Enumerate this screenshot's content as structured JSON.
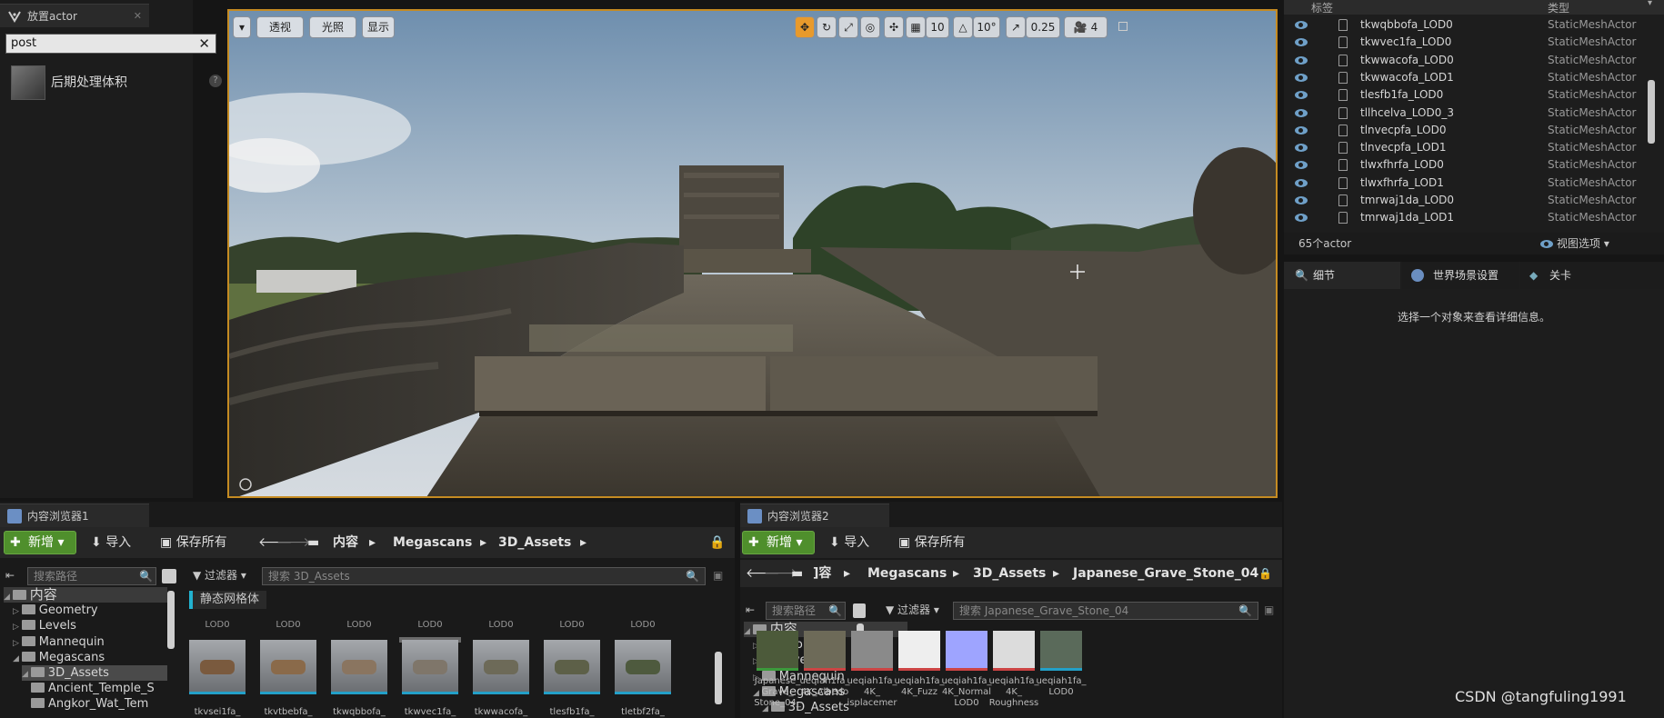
{
  "place_panel": {
    "tab": "放置actor",
    "search_value": "post",
    "item_label": "后期处理体积"
  },
  "viewport": {
    "perspective_label": "透视",
    "lighting_label": "光照",
    "show_label": "显示",
    "grid_snap": "10",
    "rotation_snap": "10°",
    "scale_snap": "0.25",
    "camera_speed": "4"
  },
  "outliner": {
    "col_label": "标签",
    "col_type": "类型",
    "rows": [
      {
        "name": "tkwqbbofa_LOD0",
        "type": "StaticMeshActor"
      },
      {
        "name": "tkwvec1fa_LOD0",
        "type": "StaticMeshActor"
      },
      {
        "name": "tkwwacofa_LOD0",
        "type": "StaticMeshActor"
      },
      {
        "name": "tkwwacofa_LOD1",
        "type": "StaticMeshActor"
      },
      {
        "name": "tlesfb1fa_LOD0",
        "type": "StaticMeshActor"
      },
      {
        "name": "tllhcelva_LOD0_3",
        "type": "StaticMeshActor"
      },
      {
        "name": "tlnvecpfa_LOD0",
        "type": "StaticMeshActor"
      },
      {
        "name": "tlnvecpfa_LOD1",
        "type": "StaticMeshActor"
      },
      {
        "name": "tlwxfhrfa_LOD0",
        "type": "StaticMeshActor"
      },
      {
        "name": "tlwxfhrfa_LOD1",
        "type": "StaticMeshActor"
      },
      {
        "name": "tmrwaj1da_LOD0",
        "type": "StaticMeshActor"
      },
      {
        "name": "tmrwaj1da_LOD1",
        "type": "StaticMeshActor"
      }
    ],
    "count": "65个actor",
    "view_options": "视图选项"
  },
  "details": {
    "tab_details": "细节",
    "tab_world": "世界场景设置",
    "tab_level": "关卡",
    "empty": "选择一个对象来查看详细信息。"
  },
  "cb1": {
    "tab": "内容浏览器1",
    "new_label": "新增",
    "import_label": "导入",
    "save_all_label": "保存所有",
    "crumbs": [
      "内容",
      "Megascans",
      "3D_Assets"
    ],
    "path_search": "搜索路径",
    "filter_label": "过滤器",
    "asset_search": "搜索 3D_Assets",
    "filter_chip": "静态网格体",
    "tree": [
      "内容",
      "Geometry",
      "Levels",
      "Mannequin",
      "Megascans",
      "3D_Assets",
      "Ancient_Temple_S",
      "Angkor_Wat_Tem"
    ],
    "lod_labels": [
      "LOD0",
      "LOD0",
      "LOD0",
      "LOD0",
      "LOD0",
      "LOD0",
      "LOD0"
    ],
    "assets": [
      "tkvsei1fa_",
      "tkvtbebfa_",
      "tkwqbbofa_",
      "tkwvec1fa_",
      "tkwwacofa_",
      "tlesfb1fa_",
      "tletbf2fa_"
    ]
  },
  "cb2": {
    "tab": "内容浏览器2",
    "new_label": "新增",
    "import_label": "导入",
    "save_all_label": "保存所有",
    "crumbs": [
      "]容",
      "Megascans",
      "3D_Assets",
      "Japanese_Grave_Stone_04"
    ],
    "path_search": "搜索路径",
    "filter_label": "过滤器",
    "asset_search": "搜索 Japanese_Grave_Stone_04",
    "tree": [
      "内容",
      "Geometry",
      "Levels",
      "Mannequin",
      "Megascans",
      "3D_Assets"
    ],
    "assets": [
      "Japanese_ Grave_ Stone_04_",
      "ueqiah1fa_ 4K_Albedo",
      "ueqiah1fa_ 4K_ isplacemer",
      "ueqiah1fa_ 4K_Fuzz",
      "ueqiah1fa_ 4K_Normal LOD0",
      "ueqiah1fa_ 4K_ Roughness",
      "ueqiah1fa_ LOD0"
    ]
  },
  "watermark": "CSDN @tangfuling1991"
}
